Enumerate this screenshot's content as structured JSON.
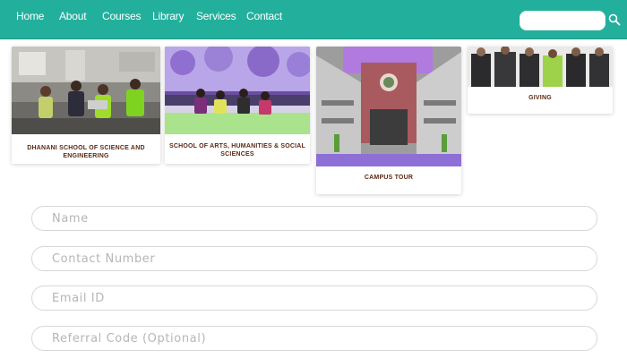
{
  "nav": {
    "links": [
      "Home",
      "About",
      "Courses",
      "Library",
      "Services",
      "Contact"
    ],
    "search_placeholder": "",
    "accent_color": "#22b09d"
  },
  "cards": [
    {
      "label": "DHANANI SCHOOL OF SCIENCE AND ENGINEERING",
      "image": "students-in-laboratory-photo"
    },
    {
      "label": "SCHOOL OF ARTS, HUMANITIES & SOCIAL SCIENCES",
      "image": "students-sitting-outdoors-photo"
    },
    {
      "label": "CAMPUS TOUR",
      "image": "campus-building-photo"
    },
    {
      "label": "GIVING",
      "image": "group-of-dignitaries-photo"
    }
  ],
  "form": {
    "name_placeholder": "Name",
    "contact_placeholder": "Contact Number",
    "email_placeholder": "Email ID",
    "referral_placeholder": "Referral Code (Optional)"
  }
}
